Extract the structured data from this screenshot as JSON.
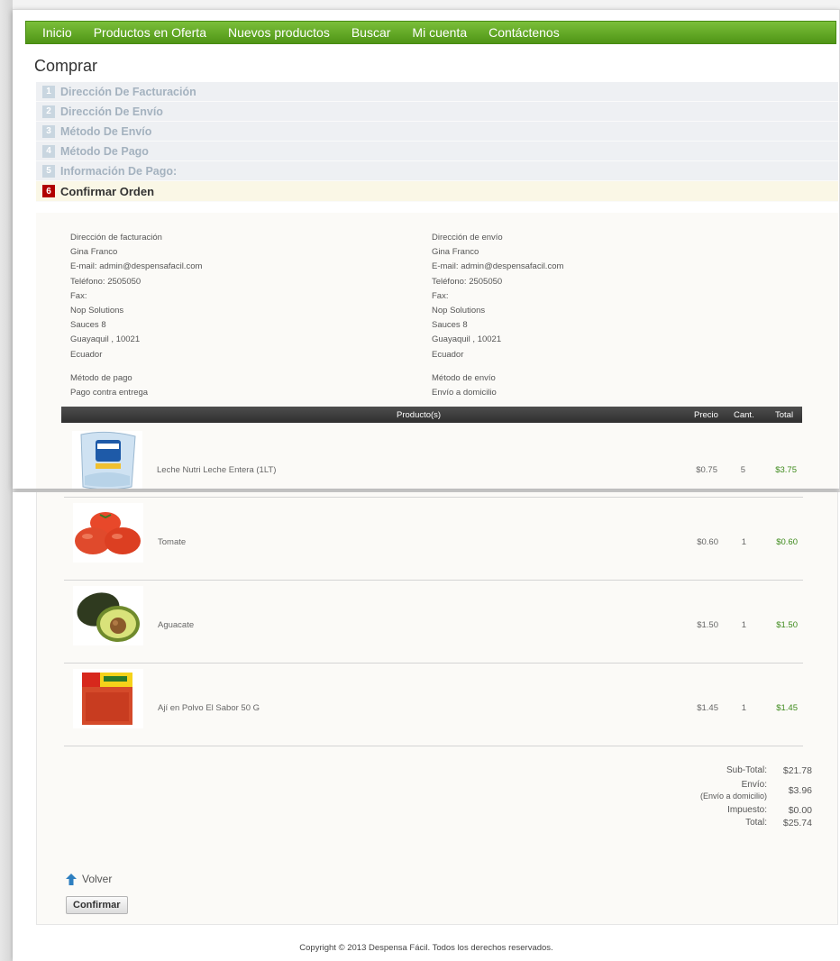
{
  "nav": {
    "items": [
      "Inicio",
      "Productos en Oferta",
      "Nuevos productos",
      "Buscar",
      "Mi cuenta",
      "Contáctenos"
    ]
  },
  "page_title": "Comprar",
  "steps": [
    {
      "num": "1",
      "label": "Dirección De Facturación"
    },
    {
      "num": "2",
      "label": "Dirección De Envío"
    },
    {
      "num": "3",
      "label": "Método De Envío"
    },
    {
      "num": "4",
      "label": "Método De Pago"
    },
    {
      "num": "5",
      "label": "Información De Pago:"
    },
    {
      "num": "6",
      "label": "Confirmar Orden"
    }
  ],
  "billing": {
    "heading": "Dirección de facturación",
    "name": "Gina Franco",
    "email": "E-mail: admin@despensafacil.com",
    "phone": "Teléfono: 2505050",
    "fax": "Fax:",
    "company": "Nop Solutions",
    "street": "Sauces 8",
    "city": "Guayaquil , 10021",
    "country": "Ecuador",
    "method_heading": "Método de pago",
    "method": "Pago contra entrega"
  },
  "shipping": {
    "heading": "Dirección de envío",
    "name": "Gina Franco",
    "email": "E-mail: admin@despensafacil.com",
    "phone": "Teléfono: 2505050",
    "fax": "Fax:",
    "company": "Nop Solutions",
    "street": "Sauces 8",
    "city": "Guayaquil , 10021",
    "country": "Ecuador",
    "method_heading": "Método de envío",
    "method": "Envío a domicilio"
  },
  "cart": {
    "headers": {
      "product": "Producto(s)",
      "price": "Precio",
      "qty": "Cant.",
      "total": "Total"
    },
    "items": [
      {
        "name": "Leche Nutri Leche Entera (1LT)",
        "price": "$0.75",
        "qty": "5",
        "total": "$3.75"
      },
      {
        "name": "Tomate",
        "price": "$0.60",
        "qty": "1",
        "total": "$0.60"
      },
      {
        "name": "Aguacate",
        "price": "$1.50",
        "qty": "1",
        "total": "$1.50"
      },
      {
        "name": "Ají en Polvo El Sabor 50 G",
        "price": "$1.45",
        "qty": "1",
        "total": "$1.45"
      }
    ]
  },
  "totals": {
    "subtotal_label": "Sub-Total:",
    "subtotal": "$21.78",
    "shipping_label": "Envío:",
    "shipping_method": "(Envío a domicilio)",
    "shipping": "$3.96",
    "tax_label": "Impuesto:",
    "tax": "$0.00",
    "total_label": "Total:",
    "total": "$25.74"
  },
  "back_label": "Volver",
  "confirm_label": "Confirmar",
  "footer": "Copyright © 2013 Despensa Fácil. Todos los derechos reservados.",
  "colors": {
    "nav_green": "#5ea422",
    "active_step_badge": "#b10000",
    "price_green": "#3d8a1b"
  }
}
